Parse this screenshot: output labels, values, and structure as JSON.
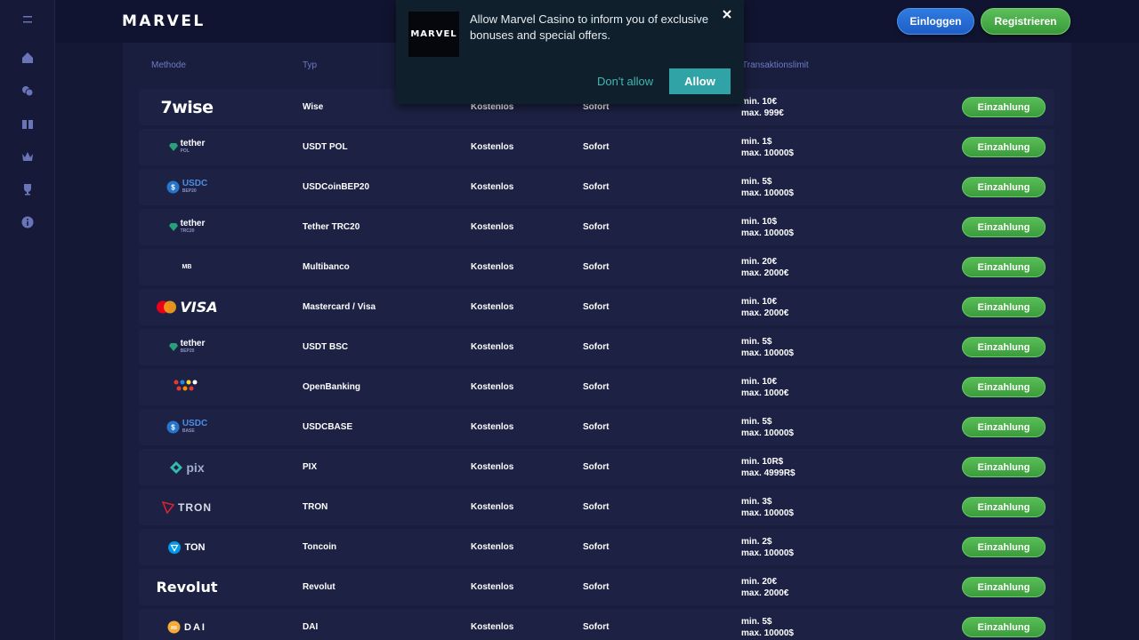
{
  "header": {
    "logo_text": "MARVEL",
    "login_label": "Einloggen",
    "register_label": "Registrieren"
  },
  "sidebar": {
    "items": [
      "menu-icon",
      "home-icon",
      "chips-icon",
      "gift-icon",
      "crown-icon",
      "trophy-icon",
      "info-icon"
    ]
  },
  "table": {
    "headers": {
      "method": "Methode",
      "type": "Typ",
      "limit": "Transaktionslimit"
    },
    "rows": [
      {
        "logo": "wise",
        "logo_text": "7wise",
        "name": "Wise",
        "fee": "Kostenlos",
        "time": "Sofort",
        "min": "min. 10€",
        "max": "max. 999€",
        "action": "Einzahlung"
      },
      {
        "logo": "tether",
        "logo_text": "tether",
        "logo_sub": "POL",
        "name": "USDT POL",
        "fee": "Kostenlos",
        "time": "Sofort",
        "min": "min. 1$",
        "max": "max. 10000$",
        "action": "Einzahlung"
      },
      {
        "logo": "usdc",
        "logo_text": "USDC",
        "logo_sub": "BEP20",
        "name": "USDCoinBEP20",
        "fee": "Kostenlos",
        "time": "Sofort",
        "min": "min. 5$",
        "max": "max. 10000$",
        "action": "Einzahlung"
      },
      {
        "logo": "tether",
        "logo_text": "tether",
        "logo_sub": "TRC20",
        "name": "Tether TRC20",
        "fee": "Kostenlos",
        "time": "Sofort",
        "min": "min. 10$",
        "max": "max. 10000$",
        "action": "Einzahlung"
      },
      {
        "logo": "multibanco",
        "logo_text": "MB",
        "name": "Multibanco",
        "fee": "Kostenlos",
        "time": "Sofort",
        "min": "min. 20€",
        "max": "max. 2000€",
        "action": "Einzahlung"
      },
      {
        "logo": "visa",
        "logo_text": "VISA",
        "name": "Mastercard / Visa",
        "fee": "Kostenlos",
        "time": "Sofort",
        "min": "min. 10€",
        "max": "max. 2000€",
        "action": "Einzahlung"
      },
      {
        "logo": "tether",
        "logo_text": "tether",
        "logo_sub": "BEP20",
        "name": "USDT BSC",
        "fee": "Kostenlos",
        "time": "Sofort",
        "min": "min. 5$",
        "max": "max. 10000$",
        "action": "Einzahlung"
      },
      {
        "logo": "openbanking",
        "logo_text": "",
        "name": "OpenBanking",
        "fee": "Kostenlos",
        "time": "Sofort",
        "min": "min. 10€",
        "max": "max. 1000€",
        "action": "Einzahlung"
      },
      {
        "logo": "usdc",
        "logo_text": "USDC",
        "logo_sub": "BASE",
        "name": "USDCBASE",
        "fee": "Kostenlos",
        "time": "Sofort",
        "min": "min. 5$",
        "max": "max. 10000$",
        "action": "Einzahlung"
      },
      {
        "logo": "pix",
        "logo_text": "pix",
        "name": "PIX",
        "fee": "Kostenlos",
        "time": "Sofort",
        "min": "min. 10R$",
        "max": "max. 4999R$",
        "action": "Einzahlung"
      },
      {
        "logo": "tron",
        "logo_text": "TRON",
        "name": "TRON",
        "fee": "Kostenlos",
        "time": "Sofort",
        "min": "min. 3$",
        "max": "max. 10000$",
        "action": "Einzahlung"
      },
      {
        "logo": "ton",
        "logo_text": "TON",
        "name": "Toncoin",
        "fee": "Kostenlos",
        "time": "Sofort",
        "min": "min. 2$",
        "max": "max. 10000$",
        "action": "Einzahlung"
      },
      {
        "logo": "revolut",
        "logo_text": "Revolut",
        "name": "Revolut",
        "fee": "Kostenlos",
        "time": "Sofort",
        "min": "min. 20€",
        "max": "max. 2000€",
        "action": "Einzahlung"
      },
      {
        "logo": "dai",
        "logo_text": "DAI",
        "name": "DAI",
        "fee": "Kostenlos",
        "time": "Sofort",
        "min": "min. 5$",
        "max": "max. 10000$",
        "action": "Einzahlung"
      }
    ]
  },
  "popup": {
    "logo_text": "MARVEL",
    "message": "Allow Marvel Casino to inform you of exclusive bonuses and special offers.",
    "deny_label": "Don't allow",
    "allow_label": "Allow"
  },
  "colors": {
    "background": "#141834",
    "panel": "#1a1e3e",
    "row": "#1d2245",
    "header_text": "#6d7cc4",
    "green_button": "#4caf50",
    "blue_button": "#2f7be0",
    "teal_accent": "#2fa3a6"
  }
}
